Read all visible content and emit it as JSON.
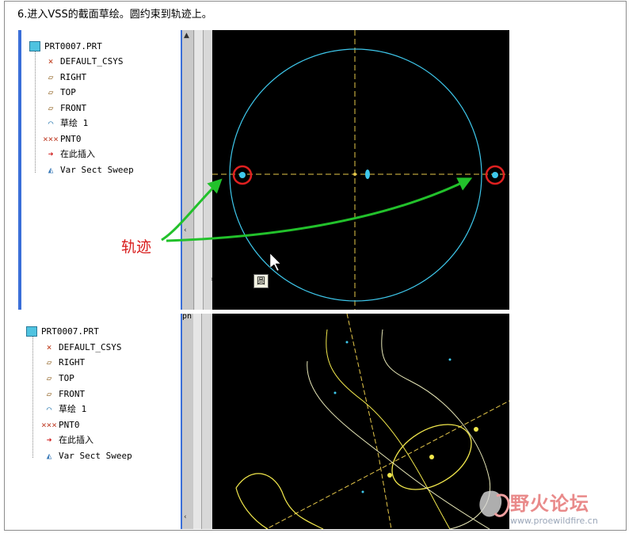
{
  "instruction": "6.进入VSS的截面草绘。圆约束到轨迹上。",
  "annotation_label": "轨迹",
  "cursor_tip": "圆",
  "panel1": {
    "root": "PRT0007.PRT",
    "items": [
      "DEFAULT_CSYS",
      "RIGHT",
      "TOP",
      "FRONT",
      "草绘 1",
      "PNT0",
      "在此插入",
      "Var Sect Sweep"
    ]
  },
  "panel2": {
    "root": "PRT0007.PRT",
    "items": [
      "DEFAULT_CSYS",
      "RIGHT",
      "TOP",
      "FRONT",
      "草绘 1",
      "PNT0",
      "在此插入",
      "Var Sect Sweep"
    ]
  },
  "scroll_tab": "pn",
  "watermark": {
    "title": "野火论坛",
    "url": "www.proewildfire.cn"
  },
  "colors": {
    "circle": "#3ec8ec",
    "axis": "#e6c84a",
    "marker": "#e02020",
    "arrow": "#22c12b",
    "sketch": "#f2e84c"
  }
}
